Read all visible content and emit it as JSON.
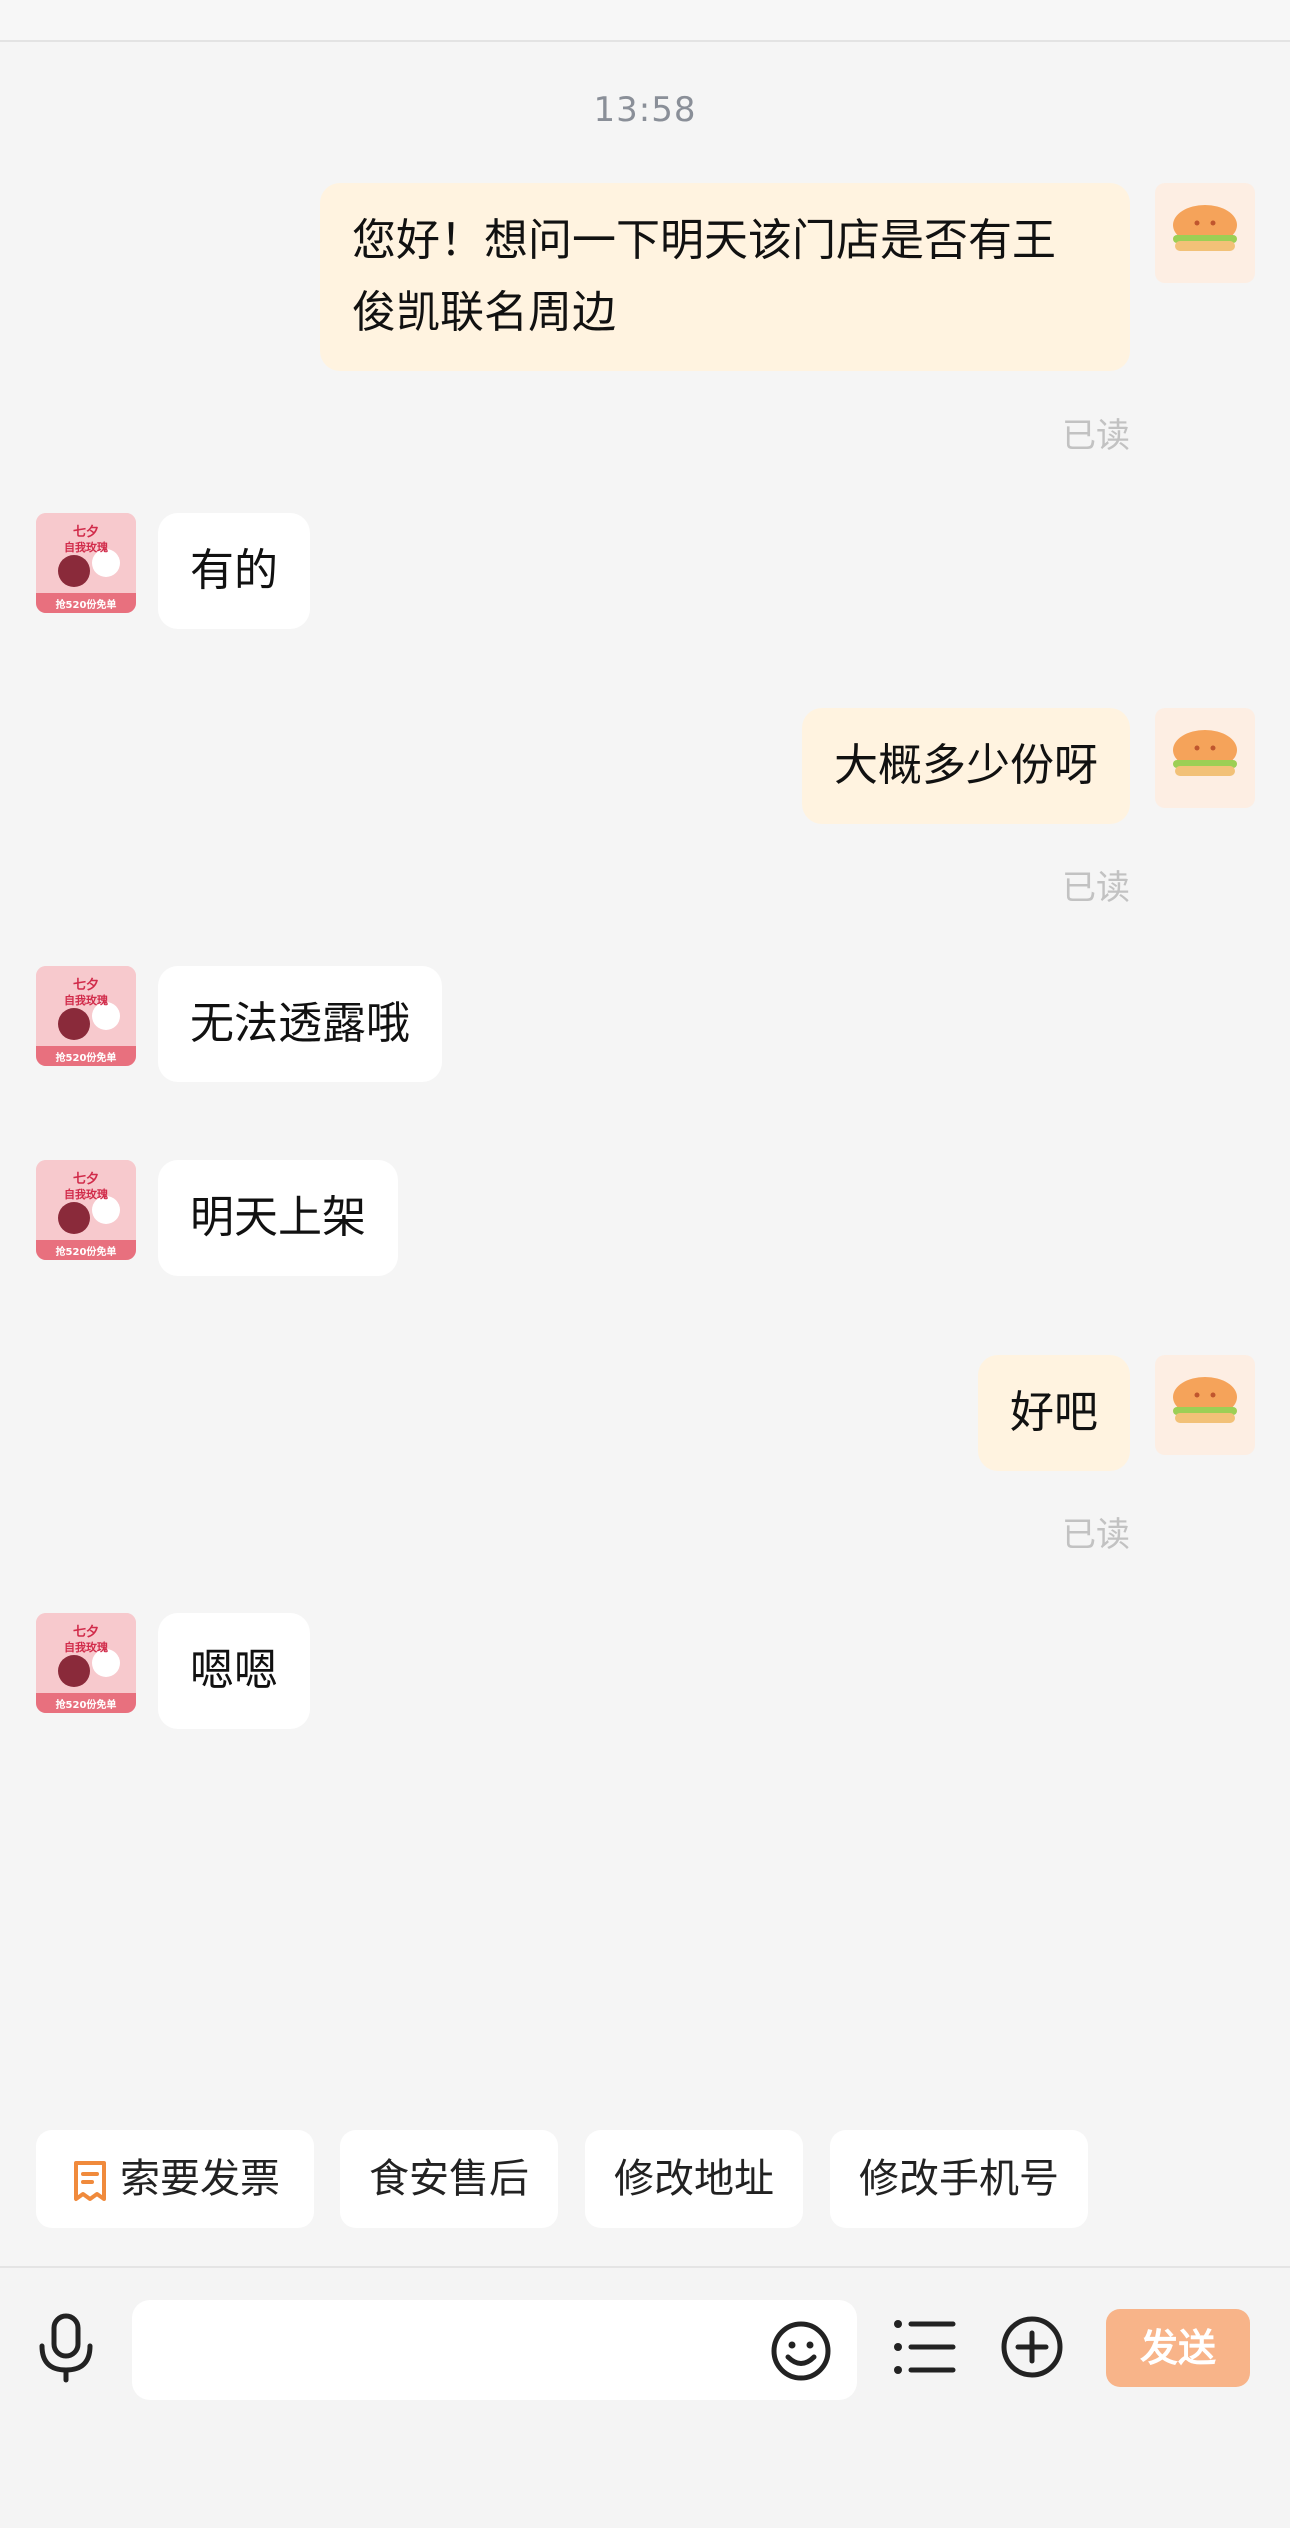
{
  "chat": {
    "timestamp": "13:58",
    "messages": [
      {
        "from": "me",
        "text": "您好！想问一下明天该门店是否有王俊凯联名周边",
        "read": "已读"
      },
      {
        "from": "shop",
        "text": "有的"
      },
      {
        "from": "me",
        "text": "大概多少份呀",
        "read": "已读"
      },
      {
        "from": "shop",
        "text": "无法透露哦"
      },
      {
        "from": "shop",
        "text": "明天上架"
      },
      {
        "from": "me",
        "text": "好吧",
        "read": "已读"
      },
      {
        "from": "shop",
        "text": "嗯嗯"
      }
    ],
    "message_lines": {
      "m0_line1": "您好！想问一下明天该门店是否有王",
      "m0_line2": "俊凯联名周边"
    },
    "shop_avatar_text": {
      "line1": "七夕",
      "line2": "自我玫瑰",
      "line3": "抢520份免单"
    }
  },
  "quick_replies": [
    {
      "label": "索要发票",
      "icon": "receipt-icon"
    },
    {
      "label": "食安售后"
    },
    {
      "label": "修改地址"
    },
    {
      "label": "修改手机号"
    }
  ],
  "input_bar": {
    "placeholder": "",
    "send_label": "发送",
    "icons": [
      "microphone-icon",
      "emoji-icon",
      "list-menu-icon",
      "plus-circle-icon"
    ]
  },
  "colors": {
    "accent": "#f8b489",
    "my_bubble": "#fff3e0",
    "shop_bubble": "#ffffff",
    "background": "#f5f5f5"
  }
}
